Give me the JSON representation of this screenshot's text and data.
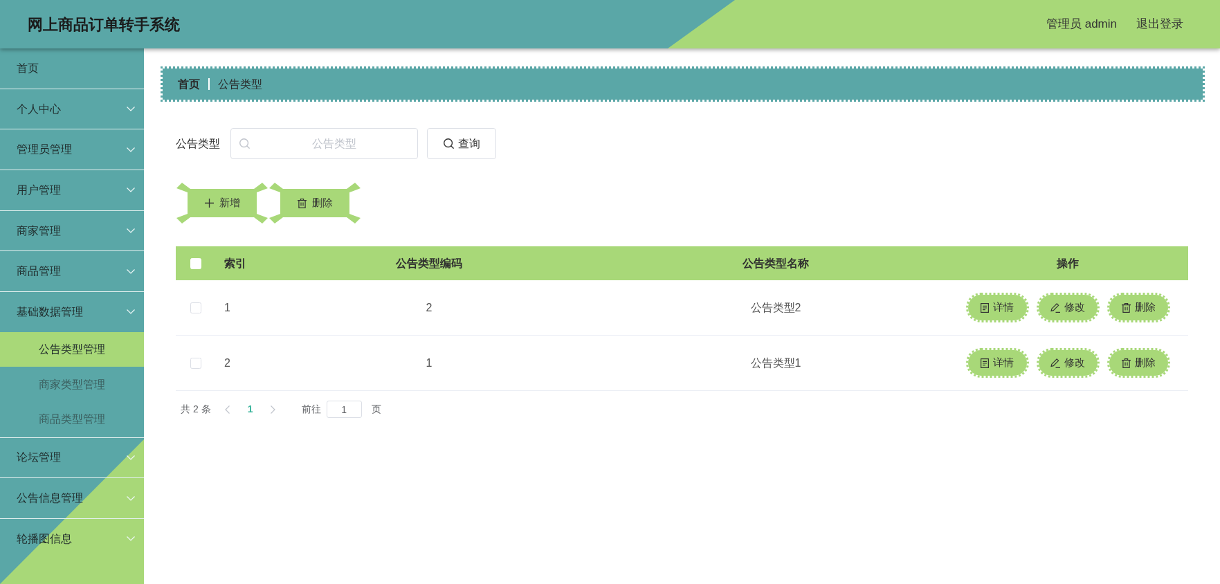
{
  "header": {
    "title": "网上商品订单转手系统",
    "user": "管理员 admin",
    "logout": "退出登录"
  },
  "sidebar": {
    "items": [
      {
        "label": "首页",
        "kind": "link",
        "selected": false
      },
      {
        "label": "个人中心",
        "kind": "submenu",
        "selected": false
      },
      {
        "label": "管理员管理",
        "kind": "submenu",
        "selected": false
      },
      {
        "label": "用户管理",
        "kind": "submenu",
        "selected": false
      },
      {
        "label": "商家管理",
        "kind": "submenu",
        "selected": false
      },
      {
        "label": "商品管理",
        "kind": "submenu",
        "selected": false
      },
      {
        "label": "基础数据管理",
        "kind": "submenu",
        "selected": false,
        "children": [
          {
            "label": "公告类型管理",
            "selected": true
          },
          {
            "label": "商家类型管理",
            "selected": false
          },
          {
            "label": "商品类型管理",
            "selected": false
          }
        ]
      },
      {
        "label": "论坛管理",
        "kind": "submenu",
        "selected": false
      },
      {
        "label": "公告信息管理",
        "kind": "submenu",
        "selected": false
      },
      {
        "label": "轮播图信息",
        "kind": "submenu",
        "selected": false
      }
    ]
  },
  "breadcrumb": [
    "首页",
    "公告类型"
  ],
  "search": {
    "label": "公告类型",
    "placeholder": "公告类型",
    "button": "查询"
  },
  "actions": [
    {
      "kind": "add",
      "label": "新增"
    },
    {
      "kind": "delete",
      "label": "删除"
    }
  ],
  "table": {
    "select_all_checked": false,
    "columns": [
      "索引",
      "公告类型编码",
      "公告类型名称",
      "操作"
    ],
    "rows": [
      {
        "checked": false,
        "cells": [
          "1",
          "2",
          "公告类型2"
        ],
        "actions": [
          {
            "kind": "detail",
            "label": "详情"
          },
          {
            "kind": "edit",
            "label": "修改"
          },
          {
            "kind": "delete",
            "label": "删除"
          }
        ]
      },
      {
        "checked": false,
        "cells": [
          "2",
          "1",
          "公告类型1"
        ],
        "actions": [
          {
            "kind": "detail",
            "label": "详情"
          },
          {
            "kind": "edit",
            "label": "修改"
          },
          {
            "kind": "delete",
            "label": "删除"
          }
        ]
      }
    ]
  },
  "pagination": {
    "total": "共 2 条",
    "pages": [
      {
        "label": "1",
        "selected": true
      }
    ],
    "goto_label": "前往",
    "goto_value": "1",
    "suffix": "页"
  }
}
